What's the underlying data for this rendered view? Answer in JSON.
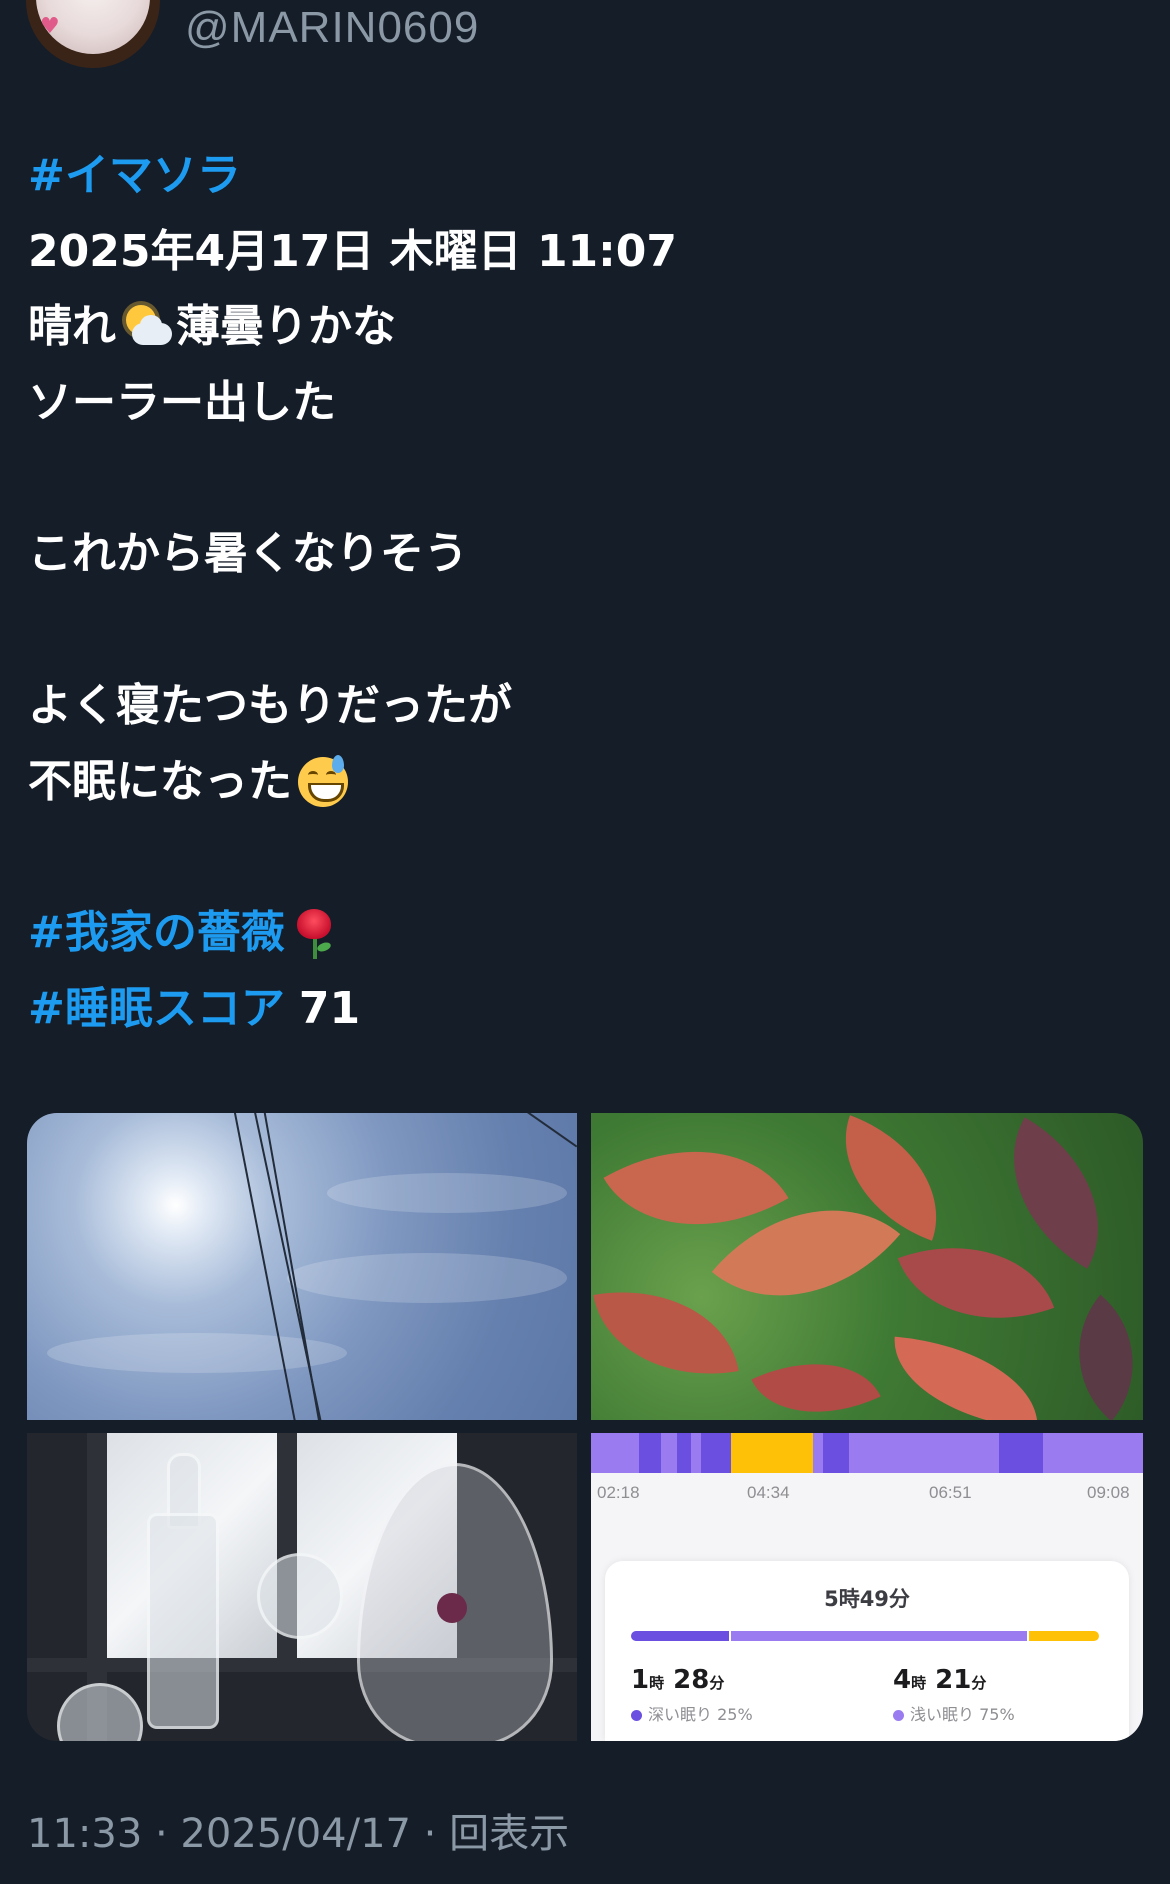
{
  "user": {
    "handle": "@MARIN0609"
  },
  "tweet": {
    "hashtag1": "#イマソラ",
    "datetime": "2025年4月17日 木曜日 11:07",
    "weather_a": "晴れ",
    "weather_b": "薄曇りかな",
    "line_solar": "ソーラー出した",
    "line_hot": "これから暑くなりそう",
    "line_sleep1": "よく寝たつもりだったが",
    "line_sleep2": "不眠になった",
    "hashtag2": "#我家の薔薇",
    "hashtag3": "#睡眠スコア",
    "score": "71",
    "emoji": {
      "weather": "sun-behind-cloud-icon",
      "sweat": "grinning-sweat-icon",
      "rose": "rose-icon"
    }
  },
  "sleep_chart": {
    "ticks": [
      "02:18",
      "04:34",
      "06:51",
      "09:08"
    ],
    "total": "5時49分",
    "deep": {
      "hours": "1",
      "h_unit": "時",
      "minutes": "28",
      "m_unit": "分",
      "label": "深い眠り 25%",
      "percent": 25
    },
    "light": {
      "hours": "4",
      "h_unit": "時",
      "minutes": "21",
      "m_unit": "分",
      "label": "浅い眠り 75%",
      "percent": 75
    },
    "colors": {
      "deep": "#6a4fe0",
      "light": "#9a7cf0",
      "awake": "#ffc107"
    }
  },
  "footer": {
    "meta": "11:33 · 2025/04/17 · 回表示"
  },
  "colors": {
    "background": "#151d28",
    "hashtag": "#1d9bf0",
    "muted": "#8b98a5"
  }
}
